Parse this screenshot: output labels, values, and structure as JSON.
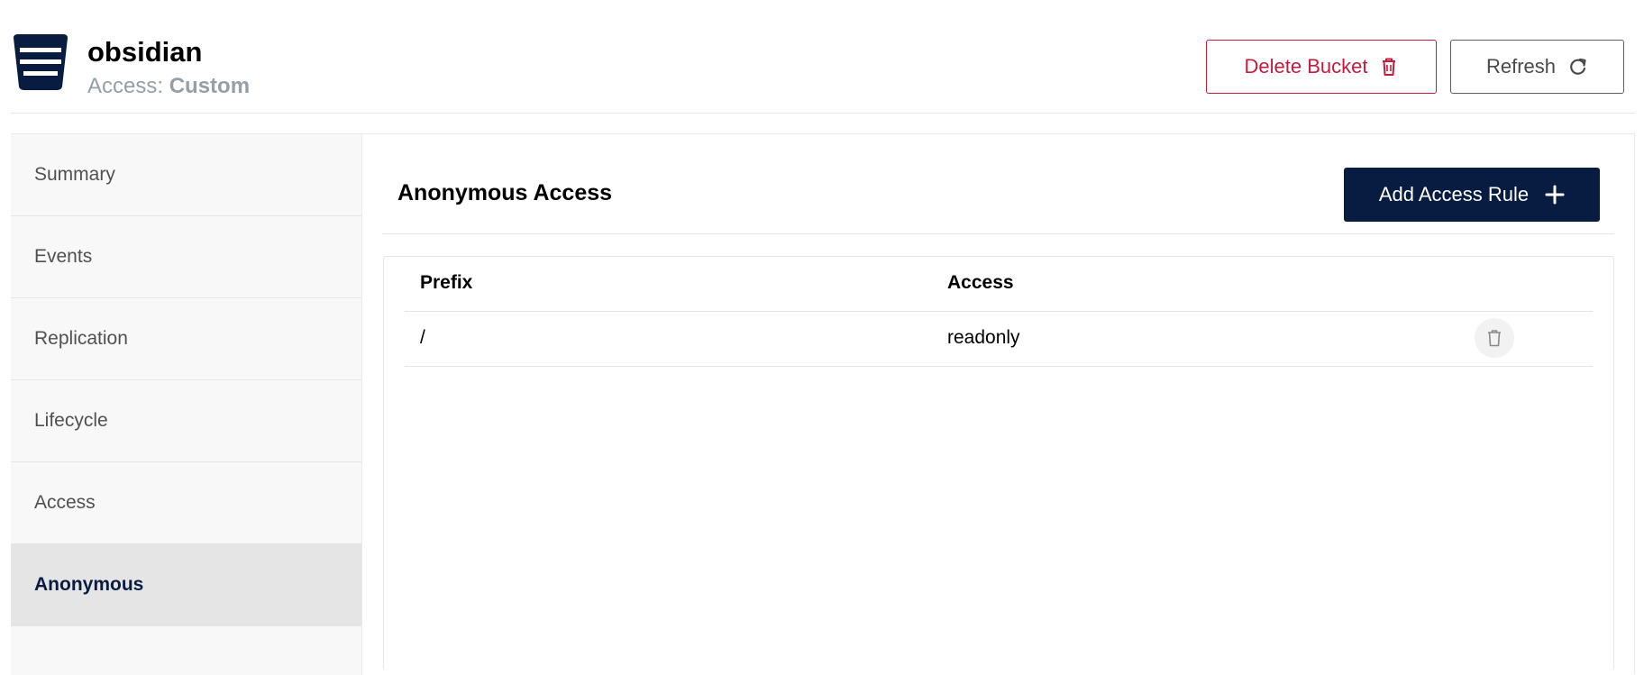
{
  "bucket": {
    "name": "obsidian",
    "access_label": "Access:",
    "access_value": "Custom"
  },
  "header": {
    "delete_label": "Delete Bucket",
    "refresh_label": "Refresh"
  },
  "sidebar": {
    "items": [
      {
        "label": "Summary"
      },
      {
        "label": "Events"
      },
      {
        "label": "Replication"
      },
      {
        "label": "Lifecycle"
      },
      {
        "label": "Access"
      },
      {
        "label": "Anonymous"
      }
    ],
    "active": "Anonymous"
  },
  "panel": {
    "title": "Anonymous Access",
    "add_label": "Add Access Rule"
  },
  "table": {
    "columns": [
      "Prefix",
      "Access"
    ],
    "rows": [
      {
        "prefix": "/",
        "access": "readonly"
      }
    ]
  },
  "colors": {
    "primary": "#081c42",
    "danger": "#c51b3c",
    "muted": "#969fa8"
  },
  "icons": {
    "bucket": "bucket-icon",
    "delete": "trash-icon",
    "refresh": "refresh-icon",
    "add": "plus-icon"
  }
}
